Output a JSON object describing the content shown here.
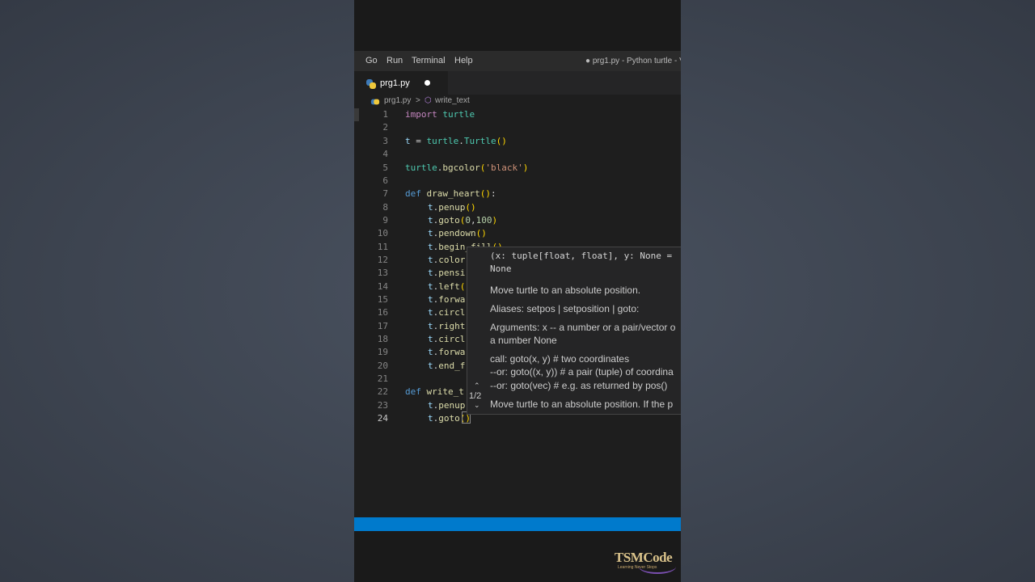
{
  "menu": {
    "items": [
      "Go",
      "Run",
      "Terminal",
      "Help"
    ],
    "window_title": "● prg1.py - Python turtle - V"
  },
  "tab": {
    "label": "prg1.py"
  },
  "breadcrumb": {
    "file": "prg1.py",
    "separator": ">",
    "symbol": "write_text"
  },
  "code_lines": [
    {
      "n": "1",
      "text": "import turtle"
    },
    {
      "n": "2",
      "text": ""
    },
    {
      "n": "3",
      "text": "t = turtle.Turtle()"
    },
    {
      "n": "4",
      "text": ""
    },
    {
      "n": "5",
      "text": "turtle.bgcolor('black')"
    },
    {
      "n": "6",
      "text": ""
    },
    {
      "n": "7",
      "text": "def draw_heart():"
    },
    {
      "n": "8",
      "text": "    t.penup()"
    },
    {
      "n": "9",
      "text": "    t.goto(0,100)"
    },
    {
      "n": "10",
      "text": "    t.pendown()"
    },
    {
      "n": "11",
      "text": "    t.begin_fill()"
    },
    {
      "n": "12",
      "text": "    t.color"
    },
    {
      "n": "13",
      "text": "    t.pensi"
    },
    {
      "n": "14",
      "text": "    t.left("
    },
    {
      "n": "15",
      "text": "    t.forwa"
    },
    {
      "n": "16",
      "text": "    t.circl"
    },
    {
      "n": "17",
      "text": "    t.right"
    },
    {
      "n": "18",
      "text": "    t.circl"
    },
    {
      "n": "19",
      "text": "    t.forwa"
    },
    {
      "n": "20",
      "text": "    t.end_f"
    },
    {
      "n": "21",
      "text": ""
    },
    {
      "n": "22",
      "text": "def write_t"
    },
    {
      "n": "23",
      "text": "    t.penup"
    },
    {
      "n": "24",
      "text": "    t.goto()"
    }
  ],
  "hover": {
    "signature_line1": "(x: tuple[float, float], y: None =",
    "signature_line2": "None",
    "desc": "Move turtle to an absolute position.",
    "aliases": "Aliases: setpos | setposition | goto:",
    "args1": "Arguments: x -- a number or a pair/vector o",
    "args2": "a number None",
    "call1": "call: goto(x, y) # two coordinates",
    "call2": "--or: goto((x, y)) # a pair (tuple) of coordina",
    "call3": "--or: goto(vec) # e.g. as returned by pos()",
    "more": "Move turtle to an absolute position. If the p",
    "pager": "1/2"
  },
  "logo": {
    "text": "TSMCode",
    "tagline": "Learning Never Stops"
  },
  "colors": {
    "status_bar": "#007acc",
    "editor_bg": "#1e1e1e",
    "keyword": "#c586c0",
    "function": "#dcdcaa"
  }
}
